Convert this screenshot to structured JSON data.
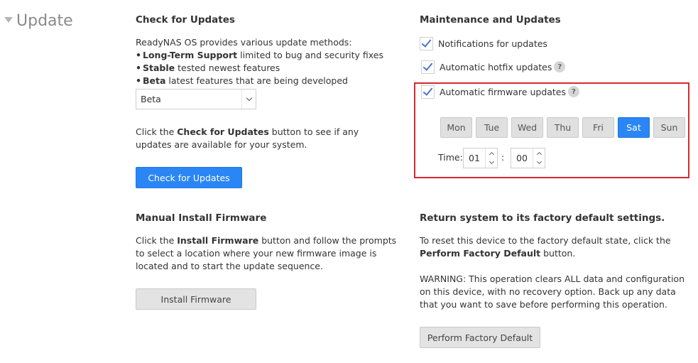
{
  "section": {
    "title": "Update"
  },
  "check": {
    "heading": "Check for Updates",
    "intro": "ReadyNAS OS provides various update methods:",
    "methods": [
      {
        "name": "Long-Term Support",
        "desc": " limited to bug and security fixes"
      },
      {
        "name": "Stable",
        "desc": " tested newest features"
      },
      {
        "name": "Beta",
        "desc": " latest features that are being developed"
      }
    ],
    "selected_method": "Beta",
    "help_pre": "Click the ",
    "help_bold": "Check for Updates",
    "help_post": " button to see if any updates are available for your system.",
    "button": "Check for Updates"
  },
  "install": {
    "heading": "Manual Install Firmware",
    "help_pre": "Click the ",
    "help_bold": "Install Firmware",
    "help_post": " button and follow the prompts to select a location where your new firmware image is located and to start the update sequence.",
    "button": "Install Firmware"
  },
  "maintenance": {
    "heading": "Maintenance and Updates",
    "notifications": {
      "label": "Notifications for updates",
      "checked": true
    },
    "hotfix": {
      "label": "Automatic hotfix updates",
      "checked": true
    },
    "firmware": {
      "label": "Automatic firmware updates",
      "checked": true
    },
    "help_glyph": "?",
    "days": [
      "Mon",
      "Tue",
      "Wed",
      "Thu",
      "Fri",
      "Sat",
      "Sun"
    ],
    "selected_day": "Sat",
    "time_label": "Time:",
    "hour": "01",
    "separator": ":",
    "minute": "00"
  },
  "factory": {
    "heading": "Return system to its factory default settings.",
    "reset_pre": "To reset this device to the factory default state, click the ",
    "reset_bold": "Perform Factory Default",
    "reset_post": " button.",
    "warning": "WARNING: This operation clears ALL data and configuration on this device, with no recovery option. Back up any data that you want to save before performing this operation.",
    "button": "Perform Factory Default"
  },
  "colors": {
    "accent": "#2a86f4",
    "highlight_border": "#d9282f"
  }
}
